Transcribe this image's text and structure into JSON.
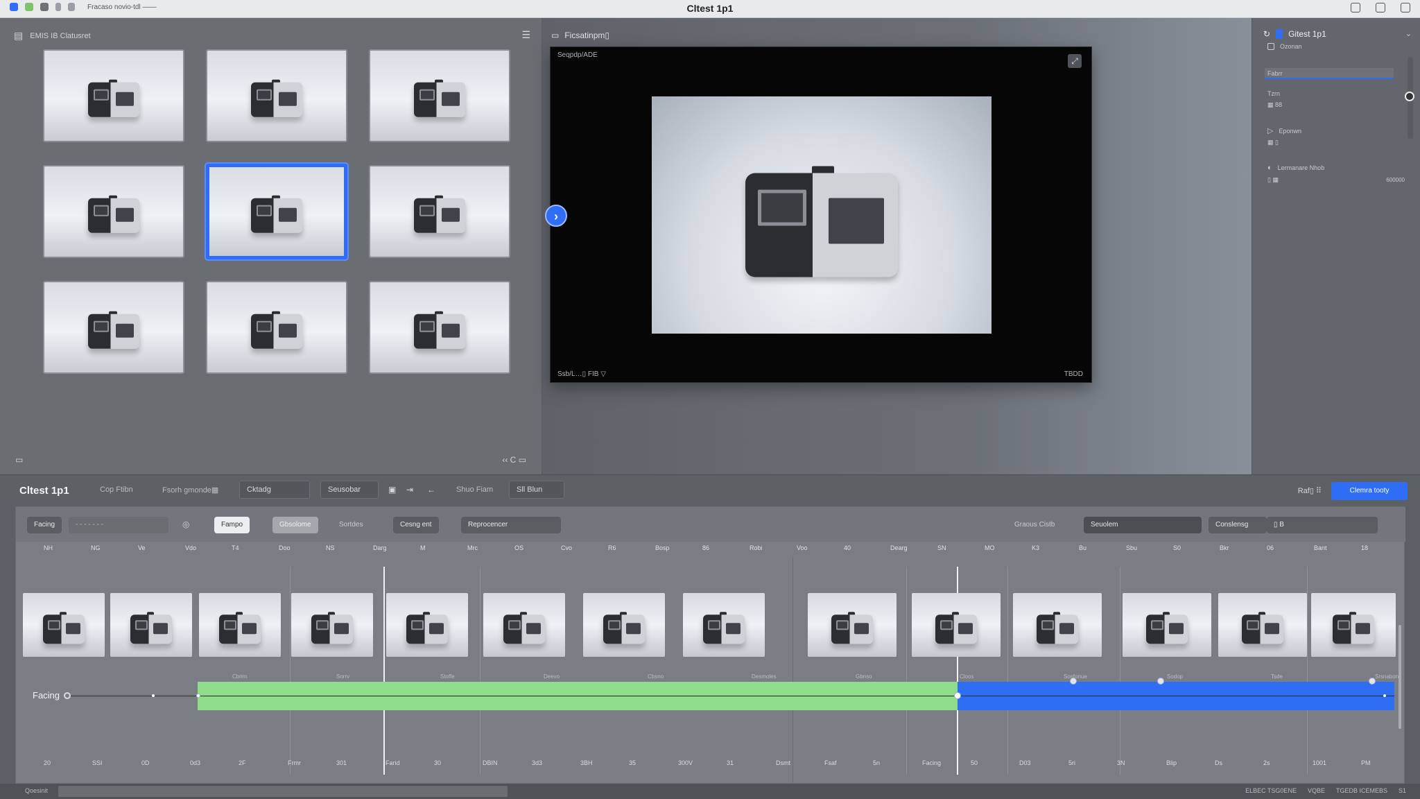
{
  "window": {
    "title": "Cltest 1p1",
    "path": "Fracaso novio-tdl ——"
  },
  "left_panel": {
    "header": "EMIS IB Clatusret",
    "footer_left": "▭",
    "footer_right": "‹‹ C  ▭"
  },
  "viewer": {
    "header": "Ficsatinpm▯",
    "top_label": "Seqpdp/ADE",
    "bottom_left": "Ssb/L…▯ FIB ▽",
    "bottom_right": "TBDD"
  },
  "inspector": {
    "title": "Gitest 1p1",
    "rows": [
      "Ozonan",
      "Fabrr",
      "Tzrn",
      "▦ 88",
      "Eponwn",
      "▦ ▯",
      "Lermanare Nhob",
      "▯ ▦"
    ],
    "right_value": "600000"
  },
  "timeline": {
    "title": "Cltest 1p1",
    "tabs": [
      "Cop Ftibn",
      "Fsorh gmonde▦"
    ],
    "boxes": [
      "Cktadg",
      "Seusobar",
      "Shuo Fiam",
      "Sll Blun"
    ],
    "cta": "Clemra tooty",
    "right_icons": "Raf▯  ⠿",
    "toolbar": {
      "facing": "Facing",
      "dropdown": "- - - - - - -",
      "btn_light": "Fampo",
      "btn_mid": "Gbsolome",
      "btn_plain": "Sortdes",
      "btn_dark1": "Cesng ent",
      "btn_dark2": "Reprocencer",
      "right_label": "Graous   Cistb",
      "right_btn1": "Seuolem",
      "right_btn2": "Conslensg",
      "right_select": "▯  B"
    },
    "ruler_top": [
      "NH",
      "NG",
      "Ve",
      "Vdo",
      "T4",
      "Doo",
      "NS",
      "Darg",
      "M",
      "Mrc",
      "OS",
      "Cvo",
      "R6",
      "Bosp",
      "86",
      "Robi",
      "Voo",
      "40",
      "Dearg",
      "SN",
      "MO",
      "K3",
      "Bu",
      "Sbu",
      "S0",
      "Bkr",
      "06",
      "Bant",
      "18"
    ],
    "track_label": "Facing",
    "sublabels": [
      "Cbrim",
      "Sorrv",
      "Stoffe",
      "Deevo",
      "Cbsno",
      "Desmoles",
      "Gbnso",
      "Cloos",
      "Sosfonue",
      "Sodop",
      "Tsde",
      "Srsnabon"
    ],
    "ruler_bottom": [
      "20",
      "SSI",
      "0D",
      "0d3",
      "2F",
      "Frmr",
      "301",
      "Farid",
      "30",
      "DBIN",
      "3d3",
      "3BH",
      "35",
      "300V",
      "31",
      "Dsmt",
      "Fsaf",
      "5n",
      "Facing",
      "50",
      "D03",
      "5ri",
      "3N",
      "Blip",
      "Ds",
      "2s",
      "1001",
      "PM"
    ]
  },
  "status": {
    "left": "Qoesinit",
    "right": [
      "ELBEC TSG0ENE",
      "VQBE",
      "TGEDB ICEMEBS",
      "S1"
    ]
  }
}
